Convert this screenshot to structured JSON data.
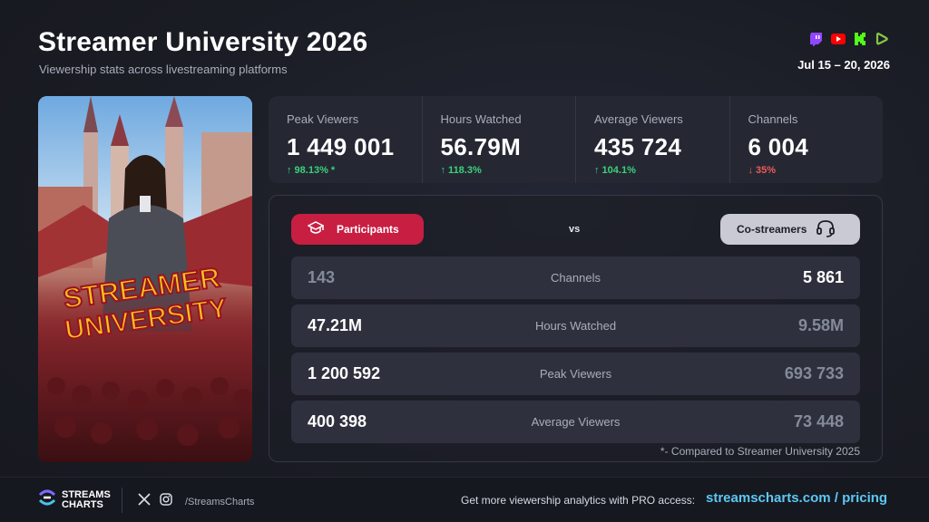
{
  "header": {
    "title": "Streamer University 2026",
    "subtitle": "Viewership stats across livestreaming platforms",
    "date_range": "Jul 15 – 20, 2026",
    "platforms": [
      "twitch-icon",
      "youtube-icon",
      "kick-icon",
      "rumble-icon"
    ]
  },
  "poster": {
    "line1": "STREAMER",
    "line2": "UNIVERSITY"
  },
  "stats": [
    {
      "label": "Peak Viewers",
      "value": "1 449 001",
      "change": "↑ 98.13% *",
      "direction": "up"
    },
    {
      "label": "Hours Watched",
      "value": "56.79M",
      "change": "↑ 118.3%",
      "direction": "up"
    },
    {
      "label": "Average Viewers",
      "value": "435 724",
      "change": "↑ 104.1%",
      "direction": "up"
    },
    {
      "label": "Channels",
      "value": "6 004",
      "change": "↓ 35%",
      "direction": "down"
    }
  ],
  "comparison": {
    "left_label": "Participants",
    "vs": "vs",
    "right_label": "Co-streamers",
    "rows": [
      {
        "left": "143",
        "metric": "Channels",
        "right": "5 861"
      },
      {
        "left": "47.21M",
        "metric": "Hours Watched",
        "right": "9.58M"
      },
      {
        "left": "1 200 592",
        "metric": "Peak Viewers",
        "right": "693 733"
      },
      {
        "left": "400 398",
        "metric": "Average Viewers",
        "right": "73 448"
      }
    ],
    "note": "*- Compared to Streamer University 2025"
  },
  "footer": {
    "brand_line1": "STREAMS",
    "brand_line2": "CHARTS",
    "handle": "/StreamsCharts",
    "cta": "Get more viewership analytics with PRO access:",
    "link": "streamscharts.com / pricing"
  },
  "colors": {
    "accent_red": "#c81e42",
    "up_green": "#3ad27a",
    "down_red": "#f05a5a",
    "link_blue": "#5cc8f2"
  }
}
